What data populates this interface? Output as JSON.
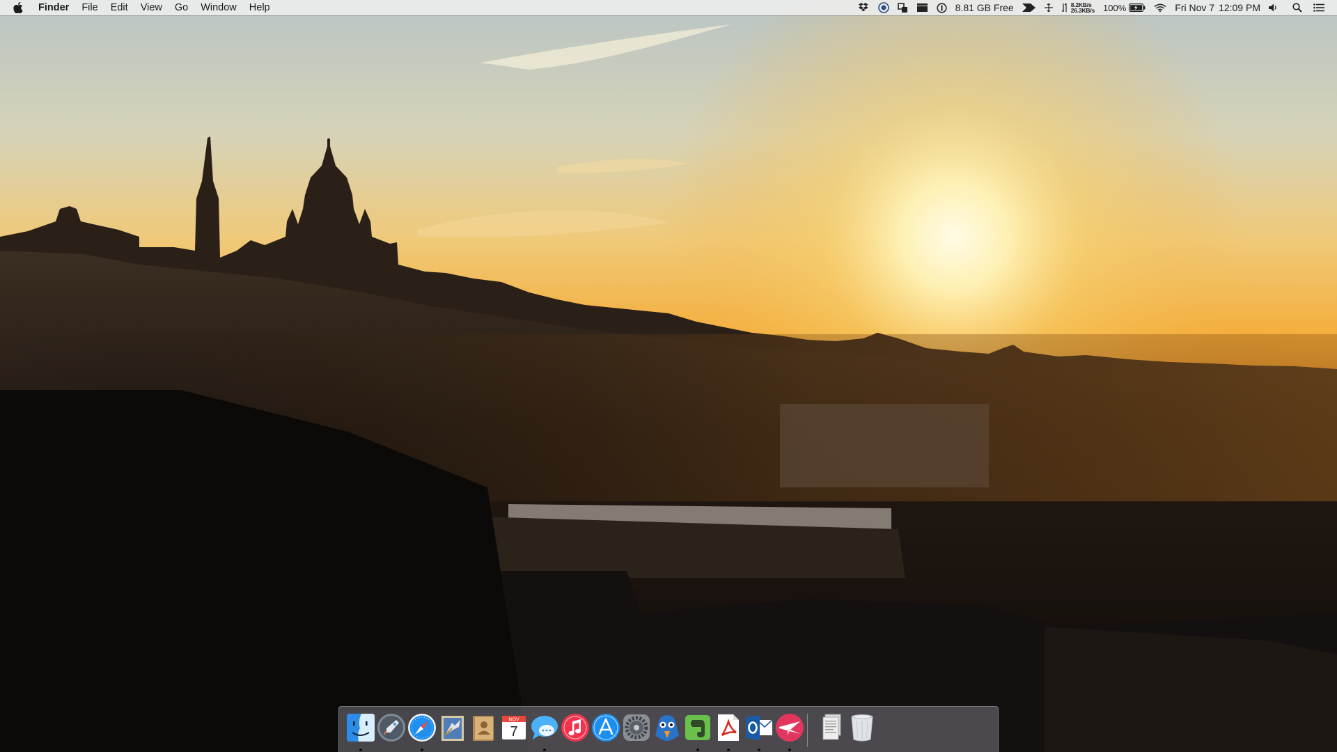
{
  "menubar": {
    "apple_icon": "apple-logo-icon",
    "app_name": "Finder",
    "menus": [
      "File",
      "Edit",
      "View",
      "Go",
      "Window",
      "Help"
    ],
    "status": {
      "disk_free": "8.81 GB Free",
      "net_up": "8.2KB/s",
      "net_down": "26.3KB/s",
      "battery_percent": "100%",
      "date": "Fri Nov 7",
      "time": "12:09 PM"
    }
  },
  "dock": {
    "apps": [
      {
        "name": "Finder",
        "icon": "finder-icon",
        "running": true
      },
      {
        "name": "Launchpad",
        "icon": "launchpad-icon",
        "running": false
      },
      {
        "name": "Safari",
        "icon": "safari-icon",
        "running": true
      },
      {
        "name": "Mail",
        "icon": "mail-icon",
        "running": false
      },
      {
        "name": "Contacts",
        "icon": "contacts-icon",
        "running": false
      },
      {
        "name": "Calendar",
        "icon": "calendar-icon",
        "running": false,
        "month": "NOV",
        "day": "7"
      },
      {
        "name": "Messages",
        "icon": "messages-icon",
        "running": true
      },
      {
        "name": "iTunes",
        "icon": "itunes-icon",
        "running": false
      },
      {
        "name": "App Store",
        "icon": "app-store-icon",
        "running": false
      },
      {
        "name": "System Preferences",
        "icon": "system-preferences-icon",
        "running": false
      },
      {
        "name": "Tweetbot",
        "icon": "tweetbot-icon",
        "running": false
      },
      {
        "name": "Evernote",
        "icon": "evernote-icon",
        "running": true
      },
      {
        "name": "Adobe Acrobat",
        "icon": "acrobat-icon",
        "running": true
      },
      {
        "name": "Outlook",
        "icon": "outlook-icon",
        "running": true
      },
      {
        "name": "Airmail",
        "icon": "airmail-icon",
        "running": true
      }
    ],
    "stack": {
      "icon": "documents-stack-icon"
    },
    "trash": {
      "icon": "trash-icon"
    }
  },
  "wallpaper": {
    "subject": "sunset-over-city-icon",
    "sky_top": "#c9cfc9",
    "sky_mid": "#f0c870",
    "sun": "#fff6c8",
    "horizon": "#f3a92c",
    "silhouette": "#2a2018"
  }
}
